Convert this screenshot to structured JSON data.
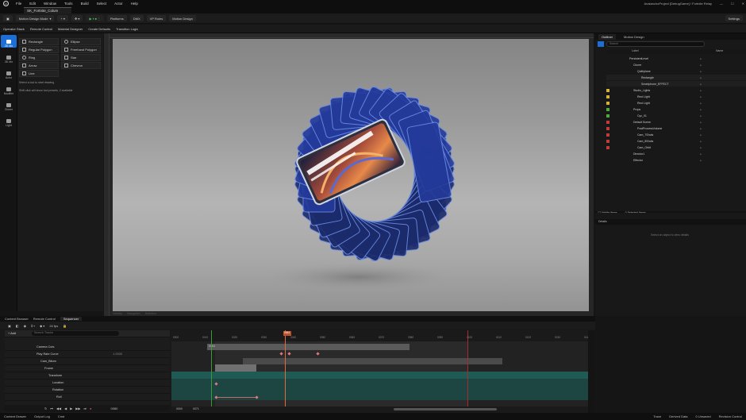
{
  "menu": {
    "items": [
      "File",
      "Edit",
      "Window",
      "Tools",
      "Build",
      "Select",
      "Actor",
      "Help"
    ],
    "project": "AnalanchoProject [DebugGame] / Fortnite Relay"
  },
  "doc_tab": "SK_Fortnite_Colum",
  "toolbar": {
    "mode": "Motion Design Mode",
    "platforms": "Platforms",
    "dmx": "DMX",
    "vp_roles": "VP Roles",
    "motion_design": "Motion Design",
    "settings": "Settings"
  },
  "toolbar2": [
    "Operator Stack",
    "Remote Control",
    "Material Designer",
    "Create Defaults",
    "Transition Logic"
  ],
  "modes": [
    "2D Mo",
    "3D Mo",
    "Actor",
    "Modifier",
    "Cloner",
    "Light"
  ],
  "tools": [
    [
      "Rectangle",
      "Ellipse"
    ],
    [
      "Regular Polygon",
      "Freehand Polygon"
    ],
    [
      "Ring",
      "Star"
    ],
    [
      "Arrow",
      "Chevron"
    ],
    [
      "Line",
      ""
    ]
  ],
  "tools_hint": [
    "Select a tool to start drawing",
    "Shift click will show tool presets, 2 available"
  ],
  "viewport": {
    "bottom": [
      "Velocity",
      "Navigation",
      "Selection"
    ]
  },
  "outliner": {
    "tabs": [
      "Outliner",
      "Motion Design"
    ],
    "search_placeholder": "Search",
    "col_label": "Label",
    "col_type": "Name",
    "rows": [
      {
        "label": "PersistentLevel",
        "indent": 0,
        "color": ""
      },
      {
        "label": "Cloner",
        "indent": 1,
        "color": ""
      },
      {
        "label": "Quilt/plane",
        "indent": 2,
        "color": ""
      },
      {
        "label": "Rectangle",
        "indent": 3,
        "color": ""
      },
      {
        "label": "Smartphone_EFFECT",
        "indent": 3,
        "color": ""
      },
      {
        "label": "Studio_Lights",
        "indent": 1,
        "color": "#d4b23a"
      },
      {
        "label": "Rect Light",
        "indent": 2,
        "color": "#d4b23a"
      },
      {
        "label": "Rect Light",
        "indent": 2,
        "color": "#d4b23a"
      },
      {
        "label": "Props",
        "indent": 1,
        "color": "#4faa3a"
      },
      {
        "label": "Cyc_01",
        "indent": 2,
        "color": "#4faa3a"
      },
      {
        "label": "Default Scene",
        "indent": 1,
        "color": "#c23b3b"
      },
      {
        "label": "PostProcessVolume",
        "indent": 2,
        "color": "#c23b3b"
      },
      {
        "label": "Cam_7Shots",
        "indent": 2,
        "color": "#c23b3b"
      },
      {
        "label": "Cam_8Shots",
        "indent": 2,
        "color": "#c23b3b"
      },
      {
        "label": "Cam_Orbit",
        "indent": 2,
        "color": "#c23b3b"
      },
      {
        "label": "Director1",
        "indent": 1,
        "color": ""
      },
      {
        "label": "Effector",
        "indent": 1,
        "color": ""
      }
    ],
    "footer": "17 Visible Items",
    "selected": "0 Selected Items"
  },
  "details": {
    "tab": "Details",
    "empty": "Select an object to view details"
  },
  "sequencer": {
    "tabs": [
      "Content Browser",
      "Remote Control",
      "Sequencer"
    ],
    "fps": "24 fps",
    "add": "Add",
    "search": "Search Tracks",
    "current_frame": "0064",
    "tracks": [
      {
        "label": "Camera Cuts",
        "indent": 0,
        "kind": "cut"
      },
      {
        "label": "Play Rate Curve",
        "indent": 0,
        "kind": "curve",
        "value": "1.0000"
      },
      {
        "label": "Cam_Bitum",
        "indent": 1,
        "kind": "group"
      },
      {
        "label": "Frame",
        "indent": 2,
        "kind": "group"
      },
      {
        "label": "Transform",
        "indent": 3,
        "kind": "group"
      },
      {
        "label": "Location",
        "indent": 4,
        "kind": "group"
      },
      {
        "label": "Rotation",
        "indent": 4,
        "kind": "group"
      },
      {
        "label": "Roll",
        "indent": 5,
        "kind": "key"
      }
    ],
    "ruler_ticks": [
      "0000",
      "0010",
      "0020",
      "0030",
      "0040",
      "0050",
      "0060",
      "0070",
      "0080",
      "0090",
      "0100",
      "0110",
      "0120",
      "0130",
      "0140"
    ],
    "frame_in": "0000",
    "frame_out": "0071",
    "bottom_frame": "0080"
  },
  "status": {
    "left": [
      "Content Drawer",
      "Output Log",
      "Cmd"
    ],
    "right": [
      "Trace",
      "Derived Data",
      "0 Unsaved",
      "Revision Control"
    ]
  }
}
